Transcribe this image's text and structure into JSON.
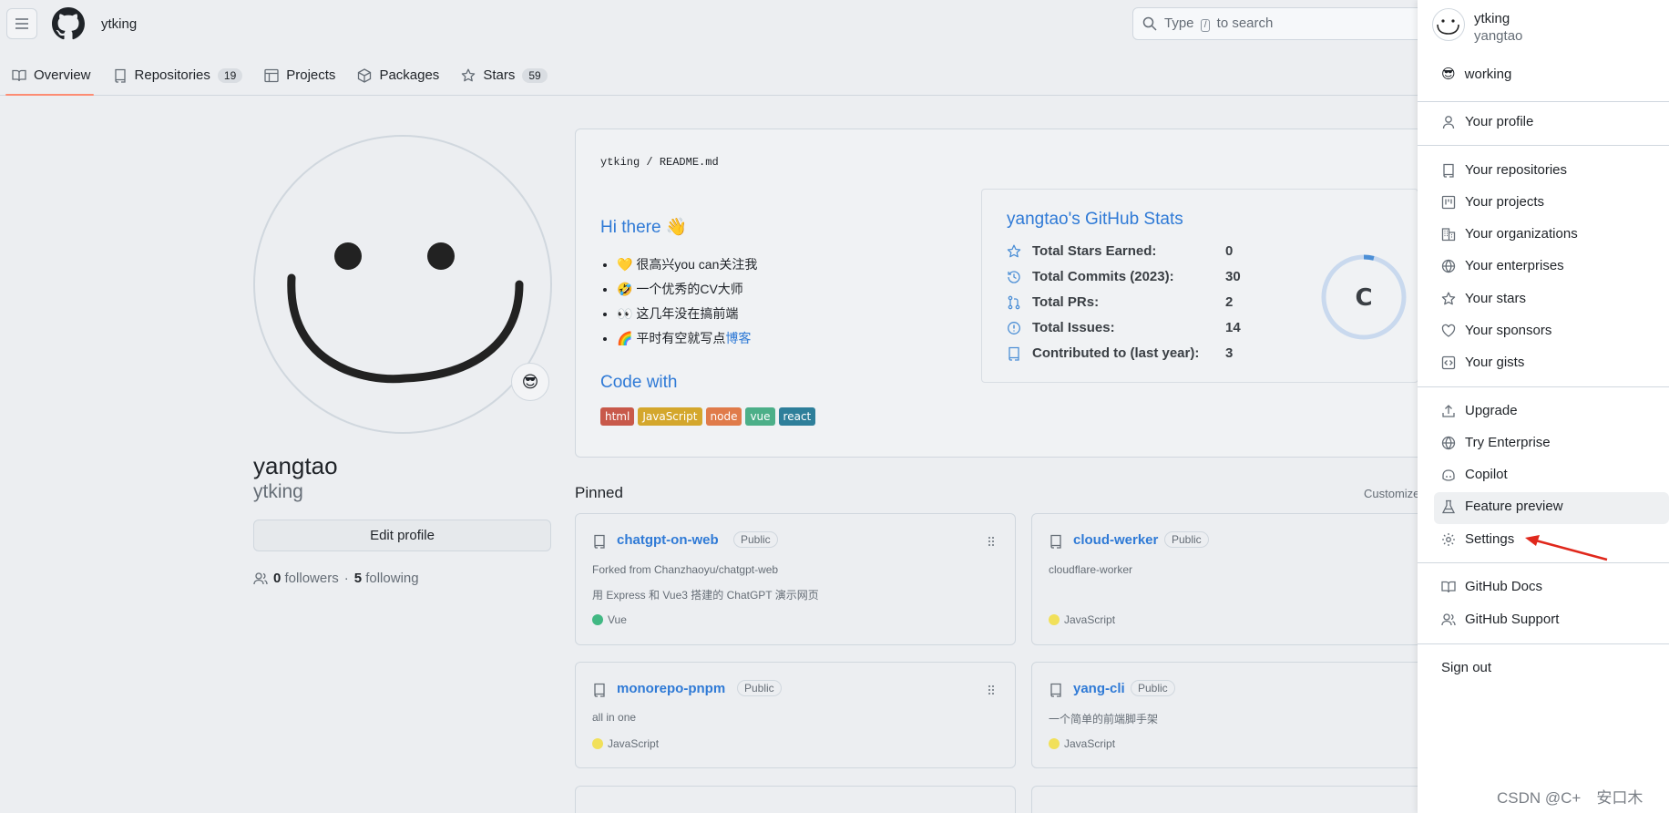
{
  "header": {
    "owner": "ytking",
    "search_placeholder_pre": "Type",
    "search_key": "/",
    "search_placeholder_post": "to search"
  },
  "tabs": [
    {
      "label": "Overview",
      "icon": "book-icon"
    },
    {
      "label": "Repositories",
      "count": "19",
      "icon": "repo-icon"
    },
    {
      "label": "Projects",
      "icon": "table-icon"
    },
    {
      "label": "Packages",
      "icon": "package-icon"
    },
    {
      "label": "Stars",
      "count": "59",
      "icon": "star-icon"
    }
  ],
  "profile": {
    "status_emoji": "😎",
    "fullname": "yangtao",
    "login": "ytking",
    "edit_label": "Edit profile",
    "followers_count": "0",
    "followers_label": "followers",
    "separator": "·",
    "following_count": "5",
    "following_label": "following"
  },
  "readme": {
    "path_owner": "ytking",
    "path_sep": "/",
    "path_file": "README.md",
    "hi": "Hi there 👋",
    "items": [
      {
        "emoji": "💛",
        "text": "很高兴you can关注我"
      },
      {
        "emoji": "🤣",
        "text": "一个优秀的CV大师"
      },
      {
        "emoji": "👀",
        "text": "这几年没在搞前端"
      },
      {
        "emoji": "🌈",
        "text": "平时有空就写点",
        "link": "博客"
      }
    ],
    "code_with": "Code with",
    "badges": [
      {
        "label": "html",
        "color": "#c8594a"
      },
      {
        "label": "JavaScript",
        "color": "#d4a72c"
      },
      {
        "label": "node",
        "color": "#e07b4a"
      },
      {
        "label": "vue",
        "color": "#4caf88"
      },
      {
        "label": "react",
        "color": "#2e7f9a"
      }
    ]
  },
  "stats": {
    "title": "yangtao's GitHub Stats",
    "rows": [
      {
        "label": "Total Stars Earned:",
        "value": "0",
        "icon": "star-outline-icon"
      },
      {
        "label": "Total Commits (2023):",
        "value": "30",
        "icon": "clock-history-icon"
      },
      {
        "label": "Total PRs:",
        "value": "2",
        "icon": "pull-request-icon"
      },
      {
        "label": "Total Issues:",
        "value": "14",
        "icon": "issue-icon"
      },
      {
        "label": "Contributed to (last year):",
        "value": "3",
        "icon": "repo-icon"
      }
    ],
    "rank": "C",
    "rank_progress": 0.04
  },
  "pinned": {
    "title": "Pinned",
    "customize": "Customize",
    "cards": [
      {
        "name": "chatgpt-on-web",
        "visibility": "Public",
        "desc1": "Forked from Chanzhaoyu/chatgpt-web",
        "desc2": "用 Express 和 Vue3 搭建的 ChatGPT 演示网页",
        "lang": "Vue",
        "lang_color": "#41b883"
      },
      {
        "name": "cloud-werker",
        "visibility": "Public",
        "desc1": "cloudflare-worker",
        "desc2": "",
        "lang": "JavaScript",
        "lang_color": "#f1e05a"
      },
      {
        "name": "monorepo-pnpm",
        "visibility": "Public",
        "desc1": "all in one",
        "desc2": "",
        "lang": "JavaScript",
        "lang_color": "#f1e05a"
      },
      {
        "name": "yang-cli",
        "visibility": "Public",
        "desc1": "一个简单的前端脚手架",
        "desc2": "",
        "lang": "JavaScript",
        "lang_color": "#f1e05a"
      }
    ]
  },
  "menu": {
    "login": "ytking",
    "name": "yangtao",
    "status_emoji": "😎",
    "status": "working",
    "items": {
      "your_profile": "Your profile",
      "your_repositories": "Your repositories",
      "your_projects": "Your projects",
      "your_organizations": "Your organizations",
      "your_enterprises": "Your enterprises",
      "your_stars": "Your stars",
      "your_sponsors": "Your sponsors",
      "your_gists": "Your gists",
      "upgrade": "Upgrade",
      "try_enterprise": "Try Enterprise",
      "copilot": "Copilot",
      "feature_preview": "Feature preview",
      "settings": "Settings",
      "github_docs": "GitHub Docs",
      "github_support": "GitHub Support",
      "sign_out": "Sign out"
    }
  },
  "watermark": "CSDN @C+　安口木",
  "colors": {
    "link": "#2f7ad6",
    "tab_underline": "#fd8c73",
    "annotation_arrow": "#e0281c"
  }
}
